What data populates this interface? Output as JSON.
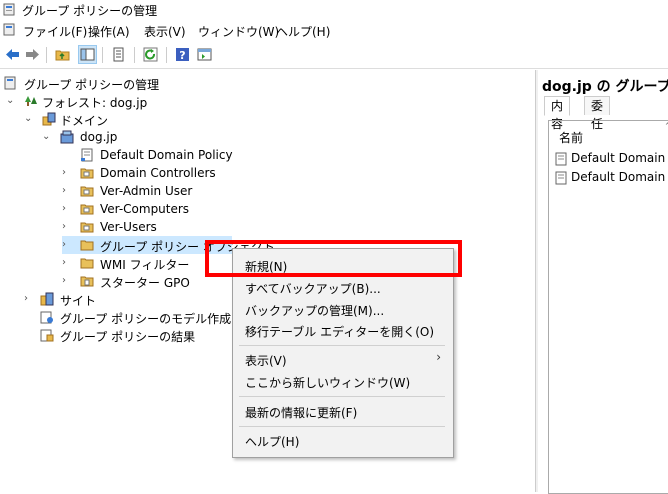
{
  "window": {
    "title": "グループ ポリシーの管理"
  },
  "menu": [
    "ファイル(F)",
    "操作(A)",
    "表示(V)",
    "ウィンドウ(W)",
    "ヘルプ(H)"
  ],
  "toolbar": {
    "icons": [
      "back-arrow-icon",
      "forward-arrow-icon",
      "up-folder-icon",
      "show-hide-console-tree-icon",
      "properties-icon",
      "refresh-icon",
      "help-icon",
      "console-icon"
    ]
  },
  "tree": {
    "root": "グループ ポリシーの管理",
    "forest": "フォレスト: dog.jp",
    "domains": "ドメイン",
    "domain": "dog.jp",
    "children": [
      "Default Domain Policy",
      "Domain Controllers",
      "Ver-Admin User",
      "Ver-Computers",
      "Ver-Users",
      "グループ ポリシー オブジェクト",
      "WMI フィルター",
      "スターター GPO"
    ],
    "sites": "サイト",
    "modeling": "グループ ポリシーのモデル作成",
    "results": "グループ ポリシーの結果"
  },
  "right_pane": {
    "title": "dog.jp の グループ",
    "tabs": [
      "内容",
      "委任"
    ],
    "column": "名前",
    "rows": [
      "Default Domain Co",
      "Default Domain Po"
    ]
  },
  "context_menu": {
    "items": {
      "new": "新規(N)",
      "backup_all": "すべてバックアップ(B)...",
      "manage_backups": "バックアップの管理(M)...",
      "migration_table": "移行テーブル エディターを開く(O)",
      "view": "表示(V)",
      "new_window": "ここから新しいウィンドウ(W)",
      "refresh": "最新の情報に更新(F)",
      "help": "ヘルプ(H)"
    },
    "submenu_arrow": "›"
  },
  "colors": {
    "highlight": "#cce8ff",
    "annotation": "#ff0000",
    "menu_bg": "#f2f2f2"
  }
}
